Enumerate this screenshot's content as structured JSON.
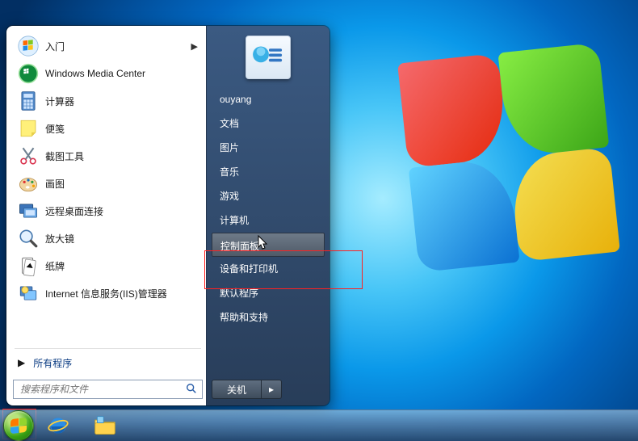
{
  "start_menu": {
    "programs": [
      {
        "id": "getting-started",
        "label": "入门",
        "icon": "flag-icon",
        "has_submenu": true
      },
      {
        "id": "wmc",
        "label": "Windows Media Center",
        "icon": "media-center-icon",
        "has_submenu": false
      },
      {
        "id": "calculator",
        "label": "计算器",
        "icon": "calculator-icon",
        "has_submenu": false
      },
      {
        "id": "sticky-notes",
        "label": "便笺",
        "icon": "sticky-note-icon",
        "has_submenu": false
      },
      {
        "id": "snipping",
        "label": "截图工具",
        "icon": "snipping-icon",
        "has_submenu": false
      },
      {
        "id": "paint",
        "label": "画图",
        "icon": "paint-icon",
        "has_submenu": false
      },
      {
        "id": "rdp",
        "label": "远程桌面连接",
        "icon": "rdp-icon",
        "has_submenu": false
      },
      {
        "id": "magnifier",
        "label": "放大镜",
        "icon": "magnifier-icon",
        "has_submenu": false
      },
      {
        "id": "solitaire",
        "label": "纸牌",
        "icon": "solitaire-icon",
        "has_submenu": false
      },
      {
        "id": "iis",
        "label": "Internet 信息服务(IIS)管理器",
        "icon": "iis-icon",
        "has_submenu": false
      }
    ],
    "all_programs_label": "所有程序",
    "search_placeholder": "搜索程序和文件"
  },
  "right_panel": {
    "username": "ouyang",
    "items": [
      {
        "id": "documents",
        "label": "文档"
      },
      {
        "id": "pictures",
        "label": "图片"
      },
      {
        "id": "music",
        "label": "音乐"
      },
      {
        "id": "games",
        "label": "游戏"
      },
      {
        "id": "computer",
        "label": "计算机"
      },
      {
        "id": "control-panel",
        "label": "控制面板",
        "hovered": true
      },
      {
        "id": "devices",
        "label": "设备和打印机"
      },
      {
        "id": "defaults",
        "label": "默认程序"
      },
      {
        "id": "help",
        "label": "帮助和支持"
      }
    ],
    "shutdown_label": "关机"
  }
}
